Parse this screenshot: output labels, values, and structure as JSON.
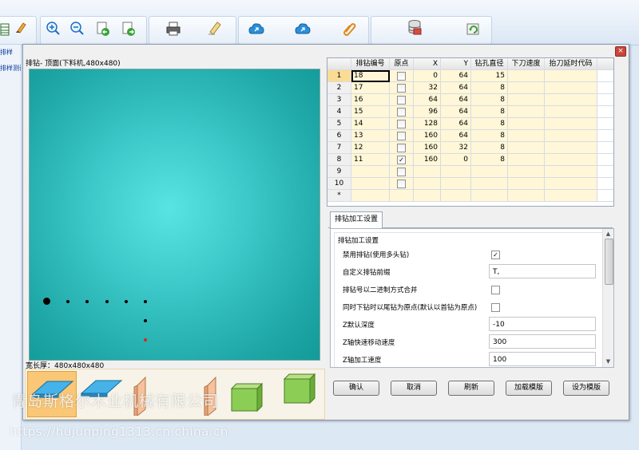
{
  "background_app": {
    "left_strip": [
      "排样",
      "排样测试"
    ]
  },
  "dialog": {
    "close_label": "×",
    "preview_title": "排钻- 顶面(下料机,480x480)",
    "thickness_label": "宽长厚：480x480x480",
    "view_buttons": [
      "view-top",
      "view-top-flat",
      "view-side-left",
      "view-side-right",
      "view-front",
      "view-iso"
    ]
  },
  "grid": {
    "columns": [
      "排钻编号",
      "原点",
      "X",
      "Y",
      "钻孔直径",
      "下刀速度",
      "抬刀延时代码"
    ],
    "rows": [
      {
        "n": "1",
        "id": "18",
        "origin": false,
        "x": "0",
        "y": "64",
        "d": "15"
      },
      {
        "n": "2",
        "id": "17",
        "origin": false,
        "x": "32",
        "y": "64",
        "d": "8"
      },
      {
        "n": "3",
        "id": "16",
        "origin": false,
        "x": "64",
        "y": "64",
        "d": "8"
      },
      {
        "n": "4",
        "id": "15",
        "origin": false,
        "x": "96",
        "y": "64",
        "d": "8"
      },
      {
        "n": "5",
        "id": "14",
        "origin": false,
        "x": "128",
        "y": "64",
        "d": "8"
      },
      {
        "n": "6",
        "id": "13",
        "origin": false,
        "x": "160",
        "y": "64",
        "d": "8"
      },
      {
        "n": "7",
        "id": "12",
        "origin": false,
        "x": "160",
        "y": "32",
        "d": "8"
      },
      {
        "n": "8",
        "id": "11",
        "origin": true,
        "x": "160",
        "y": "0",
        "d": "8"
      },
      {
        "n": "9",
        "id": "",
        "origin": false,
        "x": "",
        "y": "",
        "d": ""
      },
      {
        "n": "10",
        "id": "",
        "origin": false,
        "x": "",
        "y": "",
        "d": ""
      }
    ],
    "new_row_marker": "*"
  },
  "settings": {
    "tab_label": "排钻加工设置",
    "group_label": "排钻加工设置",
    "rows": [
      {
        "label": "禁用排钻(使用多头钻)",
        "type": "check",
        "checked": true
      },
      {
        "label": "自定义排钻前缀",
        "type": "text",
        "value": "T,"
      },
      {
        "label": "排钻号以二进制方式合并",
        "type": "check",
        "checked": false
      },
      {
        "label": "同时下钻时以尾钻为原点(默认以首钻为原点)",
        "type": "check",
        "checked": false
      },
      {
        "label": "Z默认深度",
        "type": "text",
        "value": "-10"
      },
      {
        "label": "Z轴快速移动速度",
        "type": "text",
        "value": "300"
      },
      {
        "label": "Z轴加工速度",
        "type": "text",
        "value": "100"
      }
    ]
  },
  "buttons": {
    "ok": "确认",
    "cancel": "取消",
    "refresh": "刷新",
    "load_template": "加载模版",
    "set_template": "设为模版"
  },
  "watermark": {
    "line1": "青岛斯格尔木业机械有限公司",
    "line2": "https://hujunping1313.cn.china.cn"
  },
  "colors": {
    "canvas_center": "#58e4e1",
    "canvas_edge": "#139a99",
    "selected_row": "#fbdc94",
    "grid_fill": "#fff7d7",
    "selected_view": "#f9c776"
  }
}
